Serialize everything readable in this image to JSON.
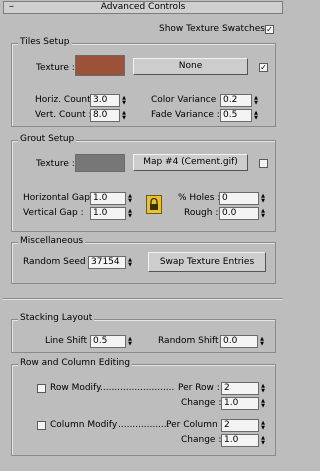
{
  "title": "Advanced Controls",
  "collapse_sign": "–",
  "show_swatches": {
    "label": "Show Texture Swatches",
    "checked": true
  },
  "tiles_setup": {
    "title": "Tiles Setup",
    "texture_label": "Texture :",
    "texture_color": "#9b5238",
    "map_button": "None",
    "map_checked": true,
    "horiz_count": {
      "label": "Horiz. Count :",
      "value": "3.0"
    },
    "vert_count": {
      "label": "Vert. Count :",
      "value": "8.0"
    },
    "color_variance": {
      "label": "Color Variance :",
      "value": "0.2"
    },
    "fade_variance": {
      "label": "Fade Variance :",
      "value": "0.5"
    }
  },
  "grout_setup": {
    "title": "Grout Setup",
    "texture_label": "Texture :",
    "texture_color": "#777777",
    "map_button": "Map #4 (Cement.gif)",
    "map_checked": false,
    "horizontal_gap": {
      "label": "Horizontal Gap :",
      "value": "1.0"
    },
    "vertical_gap": {
      "label": "Vertical Gap :",
      "value": "1.0"
    },
    "holes": {
      "label": "% Holes :",
      "value": "0"
    },
    "rough": {
      "label": "Rough :",
      "value": "0.0"
    }
  },
  "misc": {
    "title": "Miscellaneous",
    "random_seed": {
      "label": "Random Seed :",
      "value": "37154"
    },
    "swap_button": "Swap Texture Entries"
  },
  "stacking": {
    "title": "Stacking Layout",
    "line_shift": {
      "label": "Line Shift :",
      "value": "0.5"
    },
    "random_shift": {
      "label": "Random Shift :",
      "value": "0.0"
    }
  },
  "row_column": {
    "title": "Row and Column Editing",
    "row_modify": {
      "label": "Row Modify",
      "dots": "..........................",
      "checked": false
    },
    "per_row": {
      "label": "Per Row :",
      "value": "2"
    },
    "row_change": {
      "label": "Change :",
      "value": "1.0"
    },
    "column_modify": {
      "label": "Column Modify",
      "dots": "..................",
      "checked": false
    },
    "per_column": {
      "label": "Per Column :",
      "value": "2"
    },
    "column_change": {
      "label": "Change :",
      "value": "1.0"
    }
  },
  "colors": {
    "background": "#bdbdbd",
    "lock": "#e9c22f"
  }
}
